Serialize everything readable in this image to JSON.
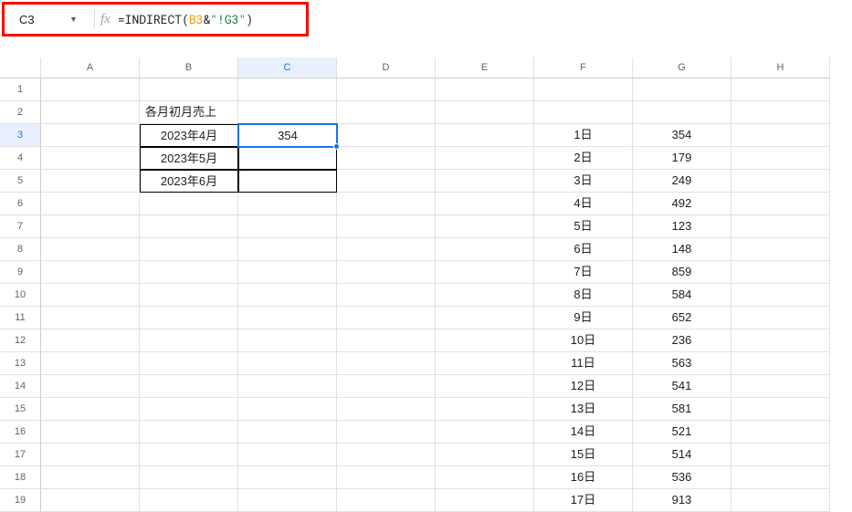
{
  "nameBox": "C3",
  "formula": {
    "raw": "=INDIRECT(B3&\"!G3\")",
    "parts": [
      {
        "t": "=",
        "c": "pun"
      },
      {
        "t": "INDIRECT",
        "c": "fn"
      },
      {
        "t": "(",
        "c": "pun"
      },
      {
        "t": "B3",
        "c": "ref"
      },
      {
        "t": "&",
        "c": "pun"
      },
      {
        "t": "\"!G3\"",
        "c": "str"
      },
      {
        "t": ")",
        "c": "pun"
      }
    ]
  },
  "fxLabel": "fx",
  "columns": [
    "A",
    "B",
    "C",
    "D",
    "E",
    "F",
    "G",
    "H"
  ],
  "rowCount": 19,
  "activeCol": "C",
  "activeRow": 3,
  "table": {
    "header": "各月初月売上",
    "rows": [
      {
        "label": "2023年4月",
        "value": "354"
      },
      {
        "label": "2023年5月",
        "value": ""
      },
      {
        "label": "2023年6月",
        "value": ""
      }
    ]
  },
  "dayData": [
    {
      "day": "1日",
      "v": "354"
    },
    {
      "day": "2日",
      "v": "179"
    },
    {
      "day": "3日",
      "v": "249"
    },
    {
      "day": "4日",
      "v": "492"
    },
    {
      "day": "5日",
      "v": "123"
    },
    {
      "day": "6日",
      "v": "148"
    },
    {
      "day": "7日",
      "v": "859"
    },
    {
      "day": "8日",
      "v": "584"
    },
    {
      "day": "9日",
      "v": "652"
    },
    {
      "day": "10日",
      "v": "236"
    },
    {
      "day": "11日",
      "v": "563"
    },
    {
      "day": "12日",
      "v": "541"
    },
    {
      "day": "13日",
      "v": "581"
    },
    {
      "day": "14日",
      "v": "521"
    },
    {
      "day": "15日",
      "v": "514"
    },
    {
      "day": "16日",
      "v": "536"
    },
    {
      "day": "17日",
      "v": "913"
    }
  ]
}
